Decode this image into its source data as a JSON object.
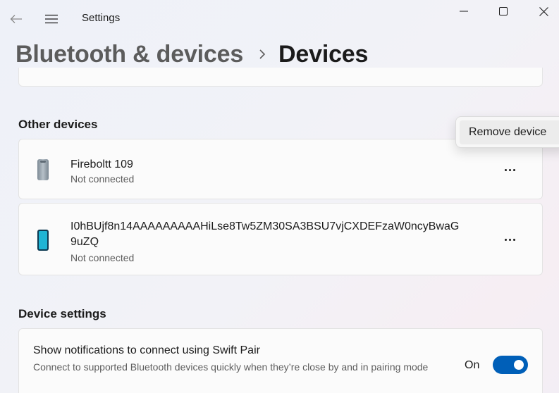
{
  "titlebar": {
    "app_title": "Settings",
    "icons": {
      "back": "back-arrow-icon",
      "menu": "hamburger-menu-icon",
      "minimize": "minimize-icon",
      "maximize": "maximize-icon",
      "close": "close-icon"
    }
  },
  "breadcrumb": {
    "parent": "Bluetooth & devices",
    "separator_icon": "chevron-right-icon",
    "current": "Devices"
  },
  "other_devices": {
    "heading": "Other devices",
    "devices": [
      {
        "name": "Fireboltt 109",
        "status": "Not connected",
        "icon": "speaker-device-icon"
      },
      {
        "name": "I0hBUjf8n14AAAAAAAAAHiLse8Tw5ZM30SA3BSU7vjCXDEFzaW0ncyBwaG",
        "name_line2": "9uZQ",
        "status": "Not connected",
        "icon": "phone-device-icon"
      }
    ]
  },
  "context_menu": {
    "items": [
      {
        "label": "Remove device"
      }
    ]
  },
  "device_settings": {
    "heading": "Device settings",
    "swift_pair": {
      "title": "Show notifications to connect using Swift Pair",
      "description": "Connect to supported Bluetooth devices quickly when they’re close by and in pairing mode",
      "toggle_label": "On",
      "toggle_on": true
    }
  },
  "colors": {
    "accent": "#005fb8",
    "background": "#f3f3f3",
    "card": "#fbfbfb"
  }
}
